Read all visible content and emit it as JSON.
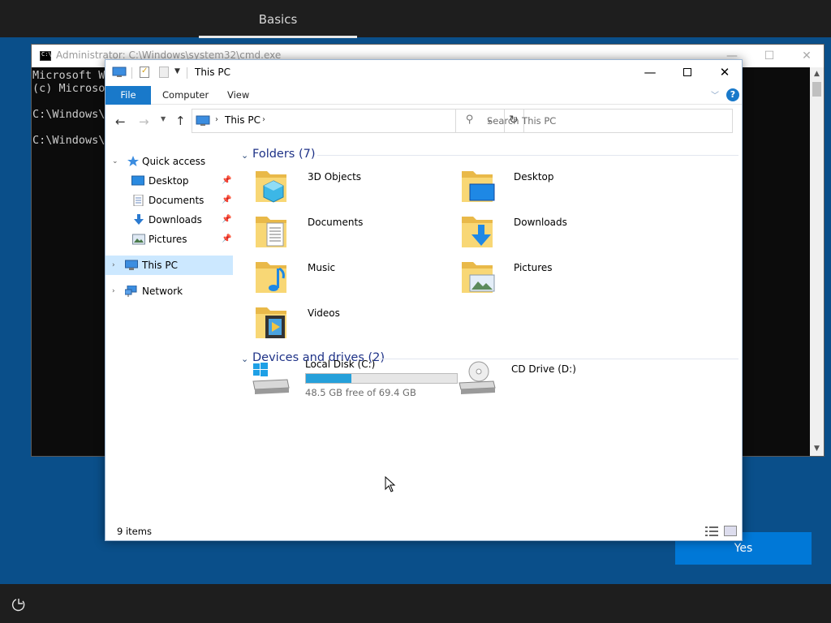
{
  "oobe": {
    "tab": "Basics",
    "yes_button": "Yes"
  },
  "cmd": {
    "title": "Administrator: C:\\Windows\\system32\\cmd.exe",
    "lines": [
      "Microsoft W",
      "(c) Microso",
      "",
      "C:\\Windows\\s",
      "",
      "C:\\Windows\\s"
    ]
  },
  "explorer": {
    "title": "This PC",
    "ribbon": {
      "file": "File",
      "computer": "Computer",
      "view": "View",
      "help": "?"
    },
    "address": {
      "path": "This PC"
    },
    "search": {
      "placeholder": "Search This PC"
    },
    "nav": {
      "quick_access": "Quick access",
      "items": [
        {
          "label": "Desktop",
          "icon": "desktop-icon",
          "pinned": true
        },
        {
          "label": "Documents",
          "icon": "documents-icon",
          "pinned": true
        },
        {
          "label": "Downloads",
          "icon": "downloads-icon",
          "pinned": true
        },
        {
          "label": "Pictures",
          "icon": "pictures-icon",
          "pinned": true
        }
      ],
      "this_pc": "This PC",
      "network": "Network"
    },
    "folders": {
      "header": "Folders (7)",
      "items": [
        {
          "label": "3D Objects",
          "icon": "3d-objects-folder-icon"
        },
        {
          "label": "Desktop",
          "icon": "desktop-folder-icon"
        },
        {
          "label": "Documents",
          "icon": "documents-folder-icon"
        },
        {
          "label": "Downloads",
          "icon": "downloads-folder-icon"
        },
        {
          "label": "Music",
          "icon": "music-folder-icon"
        },
        {
          "label": "Pictures",
          "icon": "pictures-folder-icon"
        },
        {
          "label": "Videos",
          "icon": "videos-folder-icon"
        }
      ]
    },
    "drives": {
      "header": "Devices and drives (2)",
      "items": [
        {
          "label": "Local Disk (C:)",
          "free_text": "48.5 GB free of 69.4 GB",
          "used_fraction": 0.3,
          "icon": "local-disk-icon"
        },
        {
          "label": "CD Drive (D:)",
          "icon": "cd-drive-icon"
        }
      ]
    },
    "status": {
      "count": "9 items"
    }
  },
  "colors": {
    "accent": "#0078d7",
    "ribbon_file": "#1979ca",
    "group_header": "#1e3287",
    "selection": "#cce8ff",
    "drive_fill": "#26a0da",
    "folder_yellow": "#f8d775",
    "desktop_bg": "#0a4f8a"
  }
}
